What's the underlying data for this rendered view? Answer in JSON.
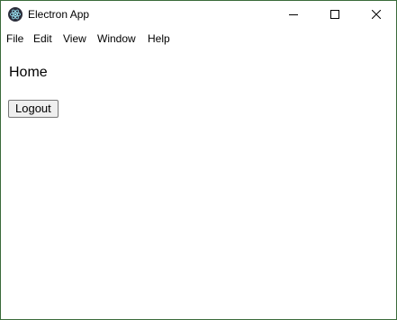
{
  "window": {
    "title": "Electron App"
  },
  "menubar": {
    "items": [
      "File",
      "Edit",
      "View",
      "Window",
      "Help"
    ]
  },
  "page": {
    "heading": "Home",
    "logout_label": "Logout"
  },
  "icons": {
    "app": "electron-logo-icon",
    "minimize": "minimize-icon",
    "maximize": "maximize-icon",
    "close": "close-icon"
  },
  "colors": {
    "window_border": "#3a6b3a",
    "background": "#ffffff",
    "button_face": "#efefef",
    "button_border": "#767676"
  }
}
